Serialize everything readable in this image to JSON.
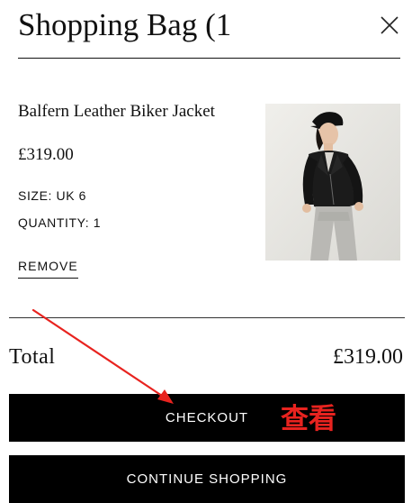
{
  "header": {
    "title": "Shopping Bag (1"
  },
  "item": {
    "name": "Balfern Leather Biker Jacket",
    "price": "£319.00",
    "size": "SIZE: UK 6",
    "quantity": "QUANTITY: 1",
    "remove_label": "REMOVE"
  },
  "summary": {
    "total_label": "Total",
    "total_value": "£319.00"
  },
  "buttons": {
    "checkout_label": "CHECKOUT",
    "continue_label": "CONTINUE SHOPPING"
  },
  "annotation": {
    "text": "查看",
    "color": "#e8231f"
  },
  "icons": {
    "close": "close-icon",
    "product": "product-image"
  },
  "colors": {
    "button_bg": "#000000",
    "button_text": "#ffffff",
    "text": "#111111"
  }
}
